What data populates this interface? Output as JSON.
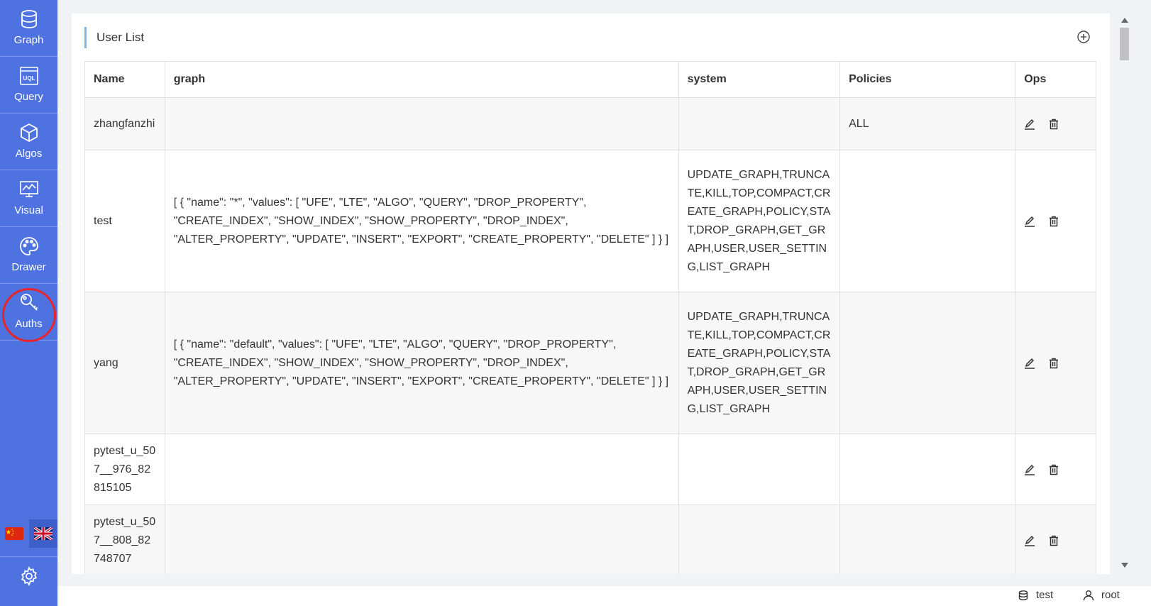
{
  "sidebar": {
    "items": [
      {
        "label": "Graph",
        "icon": "database-icon"
      },
      {
        "label": "Query",
        "icon": "uql-icon"
      },
      {
        "label": "Algos",
        "icon": "cube-icon"
      },
      {
        "label": "Visual",
        "icon": "monitor-chart-icon"
      },
      {
        "label": "Drawer",
        "icon": "palette-icon"
      },
      {
        "label": "Auths",
        "icon": "key-icon"
      }
    ],
    "active": "Auths",
    "highlight_color": "#e8232a",
    "languages": [
      "cn-flag-icon",
      "uk-flag-icon"
    ],
    "settings_icon": "gear-icon"
  },
  "card": {
    "title": "User List",
    "add_icon": "plus-circle-icon"
  },
  "table": {
    "columns": [
      "Name",
      "graph",
      "system",
      "Policies",
      "Ops"
    ],
    "rows": [
      {
        "name": "zhangfanzhi",
        "graph": "",
        "system": "",
        "policies": "ALL"
      },
      {
        "name": "test",
        "graph": "[ { \"name\": \"*\", \"values\": [ \"UFE\", \"LTE\", \"ALGO\", \"QUERY\", \"DROP_PROPERTY\", \"CREATE_INDEX\", \"SHOW_INDEX\", \"SHOW_PROPERTY\", \"DROP_INDEX\", \"ALTER_PROPERTY\", \"UPDATE\", \"INSERT\", \"EXPORT\", \"CREATE_PROPERTY\", \"DELETE\" ] } ]",
        "system": "UPDATE_GRAPH,TRUNCATE,KILL,TOP,COMPACT,CREATE_GRAPH,POLICY,STAT,DROP_GRAPH,GET_GRAPH,USER,USER_SETTING,LIST_GRAPH",
        "policies": ""
      },
      {
        "name": "yang",
        "graph": "[ { \"name\": \"default\", \"values\": [ \"UFE\", \"LTE\", \"ALGO\", \"QUERY\", \"DROP_PROPERTY\", \"CREATE_INDEX\", \"SHOW_INDEX\", \"SHOW_PROPERTY\", \"DROP_INDEX\", \"ALTER_PROPERTY\", \"UPDATE\", \"INSERT\", \"EXPORT\", \"CREATE_PROPERTY\", \"DELETE\" ] } ]",
        "system": "UPDATE_GRAPH,TRUNCATE,KILL,TOP,COMPACT,CREATE_GRAPH,POLICY,STAT,DROP_GRAPH,GET_GRAPH,USER,USER_SETTING,LIST_GRAPH",
        "policies": ""
      },
      {
        "name": "pytest_u_507__976_82815105",
        "graph": "",
        "system": "",
        "policies": ""
      },
      {
        "name": "pytest_u_507__808_82748707",
        "graph": "",
        "system": "",
        "policies": ""
      }
    ]
  },
  "footer": {
    "graph": "test",
    "user": "root"
  }
}
